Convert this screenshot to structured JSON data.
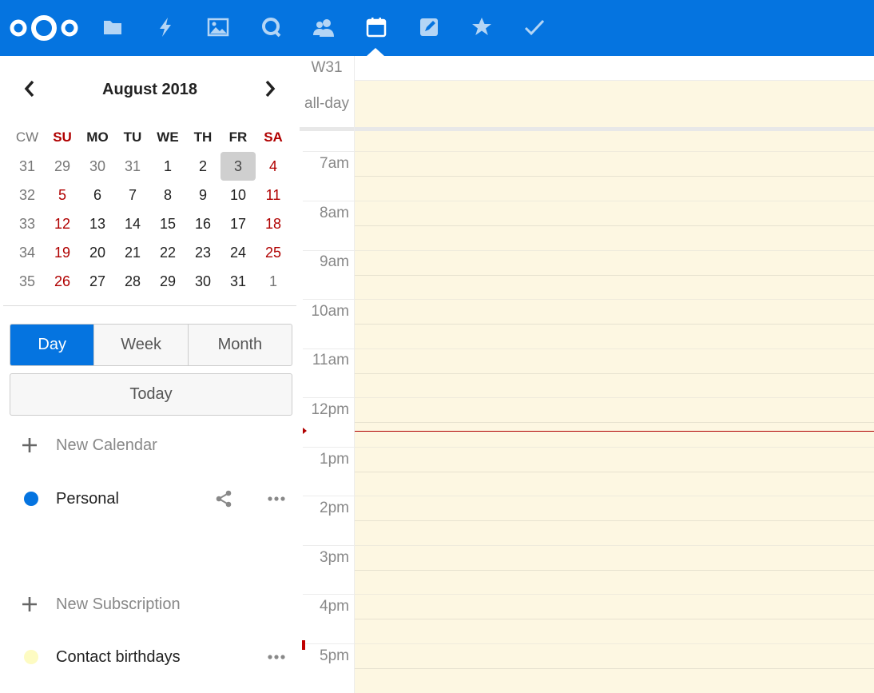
{
  "header": {
    "logo": "nextcloud-logo",
    "apps": [
      {
        "name": "files-icon"
      },
      {
        "name": "activity-icon"
      },
      {
        "name": "gallery-icon"
      },
      {
        "name": "talk-icon"
      },
      {
        "name": "contacts-icon"
      },
      {
        "name": "calendar-icon"
      },
      {
        "name": "notes-icon"
      },
      {
        "name": "bookmarks-icon"
      },
      {
        "name": "tasks-icon"
      }
    ],
    "active_app": "calendar-icon",
    "accent_color": "#0574e0"
  },
  "mini_calendar": {
    "title": "August 2018",
    "weekday_headers": [
      "CW",
      "SU",
      "MO",
      "TU",
      "WE",
      "TH",
      "FR",
      "SA"
    ],
    "weeks": [
      {
        "cw": "31",
        "days": [
          "29",
          "30",
          "31",
          "1",
          "2",
          "3",
          "4"
        ]
      },
      {
        "cw": "32",
        "days": [
          "5",
          "6",
          "7",
          "8",
          "9",
          "10",
          "11"
        ]
      },
      {
        "cw": "33",
        "days": [
          "12",
          "13",
          "14",
          "15",
          "16",
          "17",
          "18"
        ]
      },
      {
        "cw": "34",
        "days": [
          "19",
          "20",
          "21",
          "22",
          "23",
          "24",
          "25"
        ]
      },
      {
        "cw": "35",
        "days": [
          "26",
          "27",
          "28",
          "29",
          "30",
          "31",
          "1"
        ]
      }
    ],
    "selected_day": "3",
    "weekend_color": "#b00000"
  },
  "view_switch": {
    "day": "Day",
    "week": "Week",
    "month": "Month",
    "active": "Day"
  },
  "today_label": "Today",
  "calendars": {
    "new_calendar_label": "New Calendar",
    "items": [
      {
        "name": "Personal",
        "color": "#0574e0"
      }
    ]
  },
  "subscriptions": {
    "new_subscription_label": "New Subscription",
    "items": [
      {
        "name": "Contact birthdays",
        "color": "#fdfbc2"
      }
    ]
  },
  "day_view": {
    "week_label": "W31",
    "allday_label": "all-day",
    "hours": [
      "7am",
      "8am",
      "9am",
      "10am",
      "11am",
      "12pm",
      "1pm",
      "2pm",
      "3pm",
      "4pm",
      "5pm"
    ],
    "background_color": "#fdf7e2",
    "now_line_color": "#b00000"
  }
}
